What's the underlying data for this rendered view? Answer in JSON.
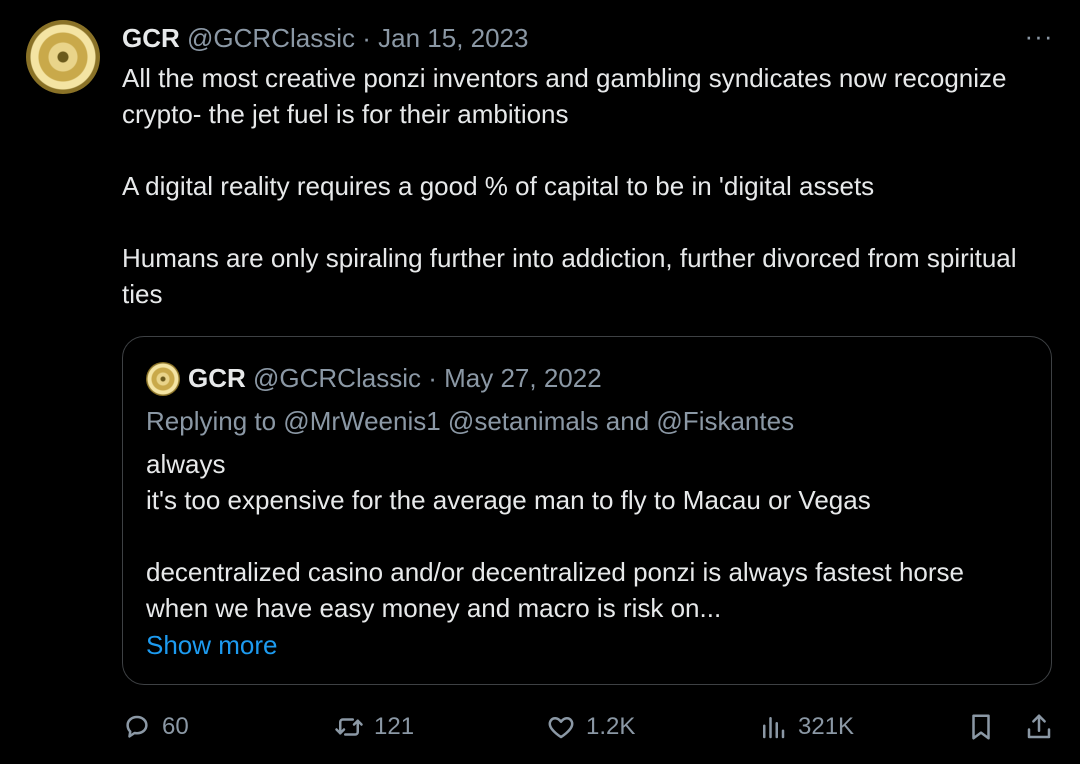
{
  "tweet": {
    "author_name": "GCR",
    "author_handle": "@GCRClassic",
    "separator": "·",
    "date": "Jan 15, 2023",
    "more_label": "···",
    "paragraphs": [
      "All the most creative ponzi inventors and gambling syndicates now recognize crypto- the jet fuel is for their ambitions",
      "A digital reality requires a good % of capital to be in 'digital assets",
      "Humans are only spiraling further into addiction, further divorced from spiritual ties"
    ]
  },
  "quote": {
    "author_name": "GCR",
    "author_handle": "@GCRClassic",
    "separator": "·",
    "date": "May 27, 2022",
    "replying_to": "Replying to @MrWeenis1 @setanimals and @Fiskantes",
    "paragraphs": [
      "always\nit's too expensive for the average man to fly to Macau or Vegas",
      "decentralized casino and/or decentralized ponzi is always fastest horse when we have easy money and macro is risk on..."
    ],
    "show_more": "Show more"
  },
  "actions": {
    "replies": "60",
    "reposts": "121",
    "likes": "1.2K",
    "views": "321K"
  },
  "icons": {
    "reply": "reply-icon",
    "repost": "repost-icon",
    "like": "heart-icon",
    "views": "views-icon",
    "bookmark": "bookmark-icon",
    "share": "share-icon",
    "more": "more-icon"
  },
  "colors": {
    "background": "#000000",
    "text": "#e7e9ea",
    "muted": "#8b98a5",
    "link": "#1d9bf0",
    "border": "#3e4144"
  }
}
